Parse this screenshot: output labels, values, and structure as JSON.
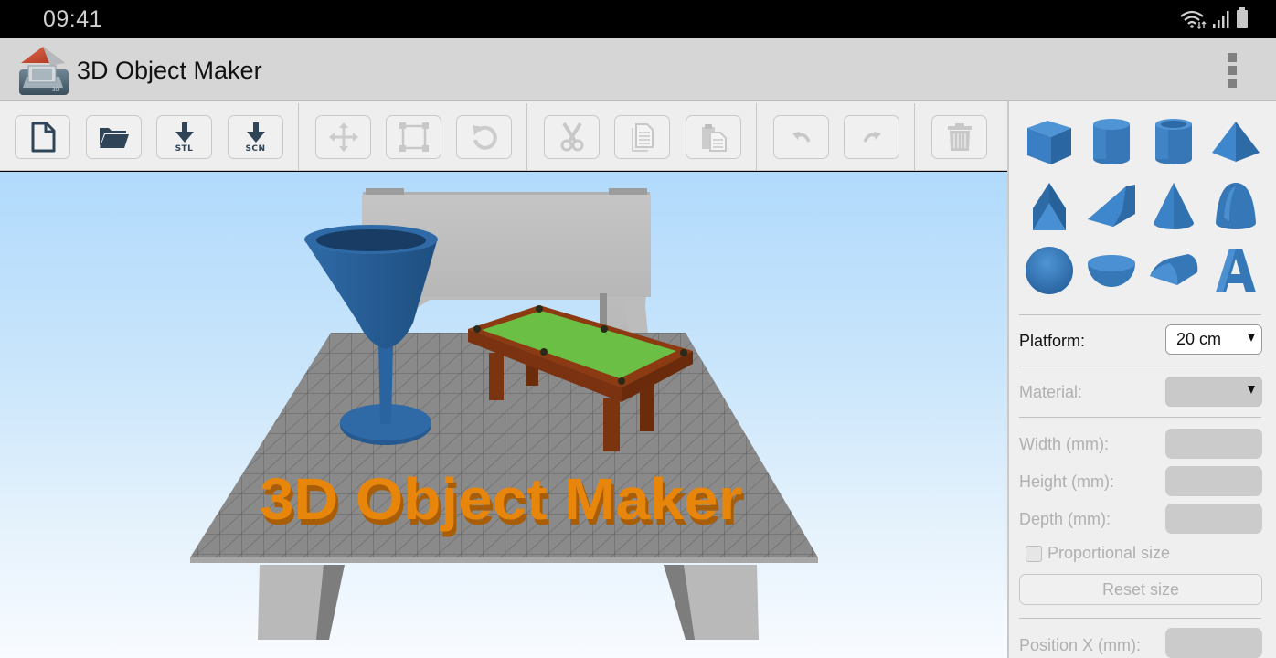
{
  "status_bar": {
    "time": "09:41",
    "icons": [
      "wifi-icon",
      "signal-icon",
      "battery-icon"
    ]
  },
  "app_bar": {
    "title": "3D Object Maker",
    "logo_icon": "app-logo-house-icon",
    "menu_icon": "overflow-menu-icon"
  },
  "toolbar": {
    "groups": [
      [
        {
          "name": "new-file",
          "icon": "new-file-icon",
          "label": "",
          "enabled": true
        },
        {
          "name": "open",
          "icon": "folder-open-icon",
          "label": "",
          "enabled": true
        },
        {
          "name": "export-stl",
          "icon": "download-icon",
          "label": "STL",
          "enabled": true
        },
        {
          "name": "export-scn",
          "icon": "download-icon",
          "label": "SCN",
          "enabled": true
        }
      ],
      [
        {
          "name": "move",
          "icon": "move-icon",
          "label": "",
          "enabled": false
        },
        {
          "name": "scale",
          "icon": "scale-icon",
          "label": "",
          "enabled": false
        },
        {
          "name": "rotate",
          "icon": "rotate-icon",
          "label": "",
          "enabled": false
        }
      ],
      [
        {
          "name": "cut",
          "icon": "scissors-icon",
          "label": "",
          "enabled": false
        },
        {
          "name": "copy",
          "icon": "copy-icon",
          "label": "",
          "enabled": false
        },
        {
          "name": "paste",
          "icon": "paste-icon",
          "label": "",
          "enabled": false
        }
      ],
      [
        {
          "name": "undo",
          "icon": "undo-icon",
          "label": "",
          "enabled": false
        },
        {
          "name": "redo",
          "icon": "redo-icon",
          "label": "",
          "enabled": false
        }
      ],
      [
        {
          "name": "delete",
          "icon": "trash-icon",
          "label": "",
          "enabled": false
        }
      ]
    ],
    "export_stl_label": "STL",
    "export_scn_label": "SCN"
  },
  "viewport": {
    "scene_text": "3D Object Maker",
    "objects": [
      "goblet",
      "pool-table",
      "bench",
      "3d-text",
      "platform-grid"
    ]
  },
  "shapes": [
    {
      "name": "cube",
      "icon": "cube-shape-icon"
    },
    {
      "name": "cylinder",
      "icon": "cylinder-shape-icon"
    },
    {
      "name": "tube",
      "icon": "tube-shape-icon"
    },
    {
      "name": "pyramid",
      "icon": "pyramid-shape-icon"
    },
    {
      "name": "triangular-pyramid",
      "icon": "triangular-pyramid-shape-icon"
    },
    {
      "name": "wedge",
      "icon": "wedge-shape-icon"
    },
    {
      "name": "cone",
      "icon": "cone-shape-icon"
    },
    {
      "name": "paraboloid",
      "icon": "paraboloid-shape-icon"
    },
    {
      "name": "sphere",
      "icon": "sphere-shape-icon"
    },
    {
      "name": "hemisphere",
      "icon": "hemisphere-shape-icon"
    },
    {
      "name": "half-cylinder",
      "icon": "half-cylinder-shape-icon"
    },
    {
      "name": "text",
      "icon": "text-shape-icon"
    }
  ],
  "properties": {
    "platform_label": "Platform:",
    "platform_value": "20 cm",
    "material_label": "Material:",
    "material_value": "",
    "width_label": "Width (mm):",
    "width_value": "",
    "height_label": "Height (mm):",
    "height_value": "",
    "depth_label": "Depth (mm):",
    "depth_value": "",
    "proportional_label": "Proportional size",
    "proportional_checked": false,
    "reset_label": "Reset size",
    "position_x_label": "Position X (mm):",
    "position_x_value": ""
  },
  "colors": {
    "shape_blue": "#3a7fc4",
    "text_orange": "#e8860c",
    "felt_green": "#6bbf45",
    "wood_brown": "#8a3a10",
    "toolbar_icon_dark": "#2f4457",
    "toolbar_icon_disabled": "#c4c4c4"
  }
}
